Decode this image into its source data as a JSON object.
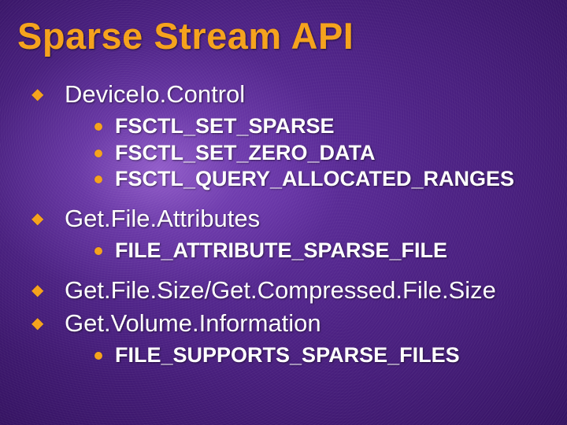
{
  "title": "Sparse Stream API",
  "items": [
    {
      "label": "DeviceIo.Control",
      "sub": [
        "FSCTL_SET_SPARSE",
        "FSCTL_SET_ZERO_DATA",
        "FSCTL_QUERY_ALLOCATED_RANGES"
      ]
    },
    {
      "label": "Get.File.Attributes",
      "sub": [
        "FILE_ATTRIBUTE_SPARSE_FILE"
      ]
    },
    {
      "label": "Get.File.Size/Get.Compressed.File.Size",
      "sub": []
    },
    {
      "label": "Get.Volume.Information",
      "sub": [
        "FILE_SUPPORTS_SPARSE_FILES"
      ]
    }
  ]
}
